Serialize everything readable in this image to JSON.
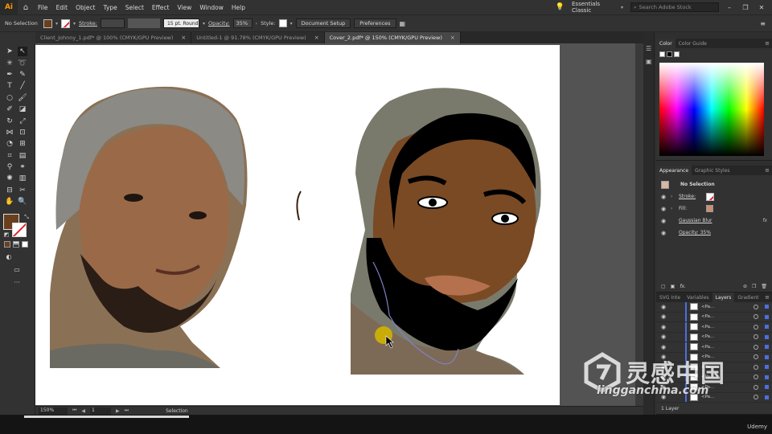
{
  "menubar": {
    "logo": "Ai",
    "items": [
      "File",
      "Edit",
      "Object",
      "Type",
      "Select",
      "Effect",
      "View",
      "Window",
      "Help"
    ],
    "workspace": "Essentials Classic",
    "search_placeholder": "Search Adobe Stock"
  },
  "control": {
    "selection": "No Selection",
    "stroke_label": "Stroke:",
    "brush": "15 pt. Round",
    "opacity_label": "Opacity:",
    "opacity_value": "35%",
    "style_label": "Style:",
    "doc_setup": "Document Setup",
    "preferences": "Preferences"
  },
  "tabs": [
    {
      "label": "Client_Johnny_1.pdf* @ 100% (CMYK/GPU Preview)",
      "active": false
    },
    {
      "label": "Untitled-1 @ 91.78% (CMYK/GPU Preview)",
      "active": false
    },
    {
      "label": "Cover_2.pdf* @ 150% (CMYK/GPU Preview)",
      "active": true
    }
  ],
  "status": {
    "zoom": "150%",
    "artboard": "1",
    "tool": "Selection"
  },
  "color_panel": {
    "tabs": [
      "Color",
      "Color Guide"
    ]
  },
  "appearance": {
    "tabs": [
      "Appearance",
      "Graphic Styles"
    ],
    "title": "No Selection",
    "rows": [
      {
        "label": "Stroke:",
        "type": "stroke"
      },
      {
        "label": "Fill:",
        "type": "fill"
      },
      {
        "label": "Gaussian Blur",
        "type": "fx"
      },
      {
        "label": "Opacity: 35%",
        "type": "opacity"
      }
    ]
  },
  "layers_panel": {
    "tabs": [
      "SVG Inte",
      "Variables",
      "Layers",
      "Gradient"
    ],
    "rows": [
      "<Pa...",
      "<Pa...",
      "<Pa...",
      "<Pa...",
      "<Pa...",
      "<Pa...",
      "<Pa...",
      "<Pa...",
      "<Pa...",
      "<Pa..."
    ],
    "footer": "1 Layer"
  },
  "watermark": {
    "cn": "灵感中国",
    "en": "lingganchina.com"
  },
  "video": {
    "brand": "Udemy"
  },
  "colors": {
    "skin": "#7a4a24",
    "hat": "#7a7a6c",
    "beard": "#000000",
    "lips": "#b5714e",
    "shirt": "#7d6a56",
    "fill_swatch": "#6a3f1e",
    "highlight_dot": "#d2b400"
  }
}
